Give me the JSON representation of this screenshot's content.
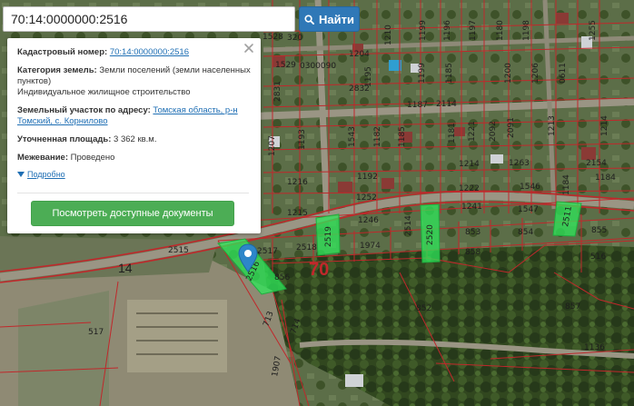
{
  "search": {
    "value": "70:14:0000000:2516",
    "button_label": "Найти"
  },
  "popup": {
    "cadastral_label": "Кадастровый номер:",
    "cadastral_value": "70:14:0000000:2516",
    "category_label": "Категория земель:",
    "category_value": "Земли поселений (земли населенных пунктов)",
    "use_value": "Индивидуальное жилищное строительство",
    "address_label": "Земельный участок по адресу:",
    "address_value": "Томская область, р-н Томский, с. Корнилово",
    "area_label": "Уточненная площадь:",
    "area_value": "3 362 кв.м.",
    "survey_label": "Межевание:",
    "survey_value": "Проведено",
    "details_label": "Подробно",
    "docs_button_label": "Посмотреть доступные документы"
  },
  "map": {
    "road_label": "14",
    "quarter_label": "70",
    "quarter_code": "0300090",
    "parcel_labels": [
      "1528",
      "320",
      "1210",
      "1196",
      "1197",
      "1180",
      "1198",
      "1199",
      "1255",
      "1529",
      "1204",
      "1195",
      "1199",
      "1185",
      "1200",
      "1206",
      "0611",
      "2831",
      "2832",
      "1187",
      "2114",
      "1193",
      "1543",
      "1182",
      "1185",
      "1181",
      "1221",
      "2092",
      "2091",
      "1213",
      "1214",
      "1263",
      "2154",
      "1192",
      "1216",
      "1252",
      "1222",
      "1546",
      "1207",
      "1184",
      "1215",
      "1246",
      "1241",
      "1547",
      "2515",
      "2517",
      "2518",
      "1974",
      "853",
      "854",
      "855",
      "856",
      "858",
      "516",
      "852",
      "857",
      "517",
      "713",
      "714",
      "1907",
      "1136",
      "840",
      "835",
      "520"
    ],
    "highlight_labels": [
      "2516",
      "2519",
      "2520",
      "2511",
      "2514"
    ]
  },
  "colors": {
    "accent_blue": "#2f78b7",
    "accent_green": "#4cad55",
    "parcel_line": "#c0282b",
    "highlight": "#2ee85a"
  }
}
